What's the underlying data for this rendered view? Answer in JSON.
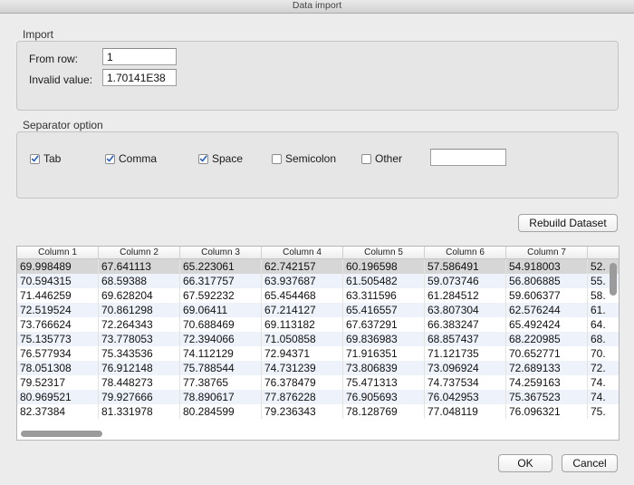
{
  "window": {
    "title": "Data import"
  },
  "import_group": {
    "label": "Import",
    "from_row_label": "From row:",
    "from_row_value": "1",
    "invalid_value_label": "Invalid value:",
    "invalid_value": "1.70141E38"
  },
  "separator_group": {
    "label": "Separator option",
    "options": [
      {
        "label": "Tab",
        "checked": true
      },
      {
        "label": "Comma",
        "checked": true
      },
      {
        "label": "Space",
        "checked": true
      },
      {
        "label": "Semicolon",
        "checked": false
      },
      {
        "label": "Other",
        "checked": false
      }
    ],
    "other_value": ""
  },
  "rebuild_button": "Rebuild Dataset",
  "table": {
    "columns": [
      "Column 1",
      "Column 2",
      "Column 3",
      "Column 4",
      "Column 5",
      "Column 6",
      "Column 7",
      ""
    ],
    "rows": [
      [
        "69.998489",
        "67.641113",
        "65.223061",
        "62.742157",
        "60.196598",
        "57.586491",
        "54.918003",
        "52."
      ],
      [
        "70.594315",
        "68.59388",
        "66.317757",
        "63.937687",
        "61.505482",
        "59.073746",
        "56.806885",
        "55."
      ],
      [
        "71.446259",
        "69.628204",
        "67.592232",
        "65.454468",
        "63.311596",
        "61.284512",
        "59.606377",
        "58."
      ],
      [
        "72.519524",
        "70.861298",
        "69.06411",
        "67.214127",
        "65.416557",
        "63.807304",
        "62.576244",
        "61."
      ],
      [
        "73.766624",
        "72.264343",
        "70.688469",
        "69.113182",
        "67.637291",
        "66.383247",
        "65.492424",
        "64."
      ],
      [
        "75.135773",
        "73.778053",
        "72.394066",
        "71.050858",
        "69.836983",
        "68.857437",
        "68.220985",
        "68."
      ],
      [
        "76.577934",
        "75.343536",
        "74.112129",
        "72.94371",
        "71.916351",
        "71.121735",
        "70.652771",
        "70."
      ],
      [
        "78.051308",
        "76.912148",
        "75.788544",
        "74.731239",
        "73.806839",
        "73.096924",
        "72.689133",
        "72."
      ],
      [
        "79.52317",
        "78.448273",
        "77.38765",
        "76.378479",
        "75.471313",
        "74.737534",
        "74.259163",
        "74."
      ],
      [
        "80.969521",
        "79.927666",
        "78.890617",
        "77.876228",
        "76.905693",
        "76.042953",
        "75.367523",
        "74."
      ],
      [
        "82.37384",
        "81.331978",
        "80.284599",
        "79.236343",
        "78.128769",
        "77.048119",
        "76.096321",
        "75."
      ]
    ]
  },
  "ok_button": "OK",
  "cancel_button": "Cancel"
}
